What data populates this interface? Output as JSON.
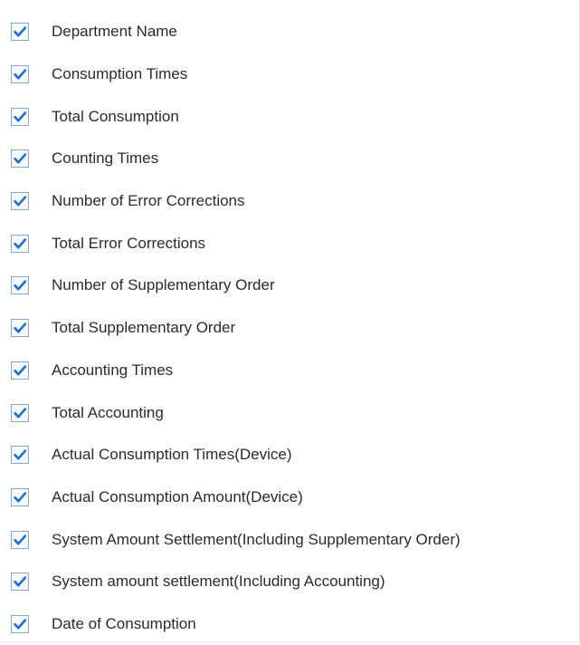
{
  "field_list": {
    "items": [
      {
        "label": "Department Name",
        "checked": true
      },
      {
        "label": "Consumption Times",
        "checked": true
      },
      {
        "label": "Total Consumption",
        "checked": true
      },
      {
        "label": "Counting Times",
        "checked": true
      },
      {
        "label": "Number of Error Corrections",
        "checked": true
      },
      {
        "label": "Total Error Corrections",
        "checked": true
      },
      {
        "label": "Number of Supplementary Order",
        "checked": true
      },
      {
        "label": "Total Supplementary Order",
        "checked": true
      },
      {
        "label": "Accounting Times",
        "checked": true
      },
      {
        "label": "Total Accounting",
        "checked": true
      },
      {
        "label": "Actual Consumption Times(Device)",
        "checked": true
      },
      {
        "label": "Actual Consumption Amount(Device)",
        "checked": true
      },
      {
        "label": "System Amount Settlement(Including Supplementary Order)",
        "checked": true
      },
      {
        "label": "System amount settlement(Including Accounting)",
        "checked": true
      },
      {
        "label": "Date of Consumption",
        "checked": true
      }
    ]
  },
  "colors": {
    "checkmark": "#1e6fc9",
    "checkbox_border": "#8aa7cc",
    "text": "#2b2b2b"
  },
  "icons": {
    "checkbox_checked": "checkmark-icon"
  }
}
